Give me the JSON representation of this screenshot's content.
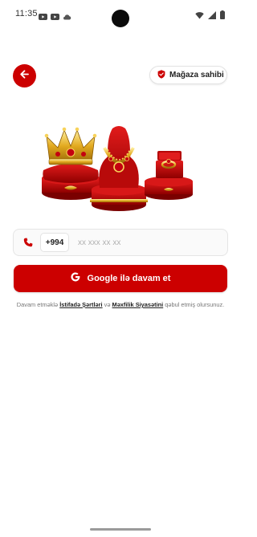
{
  "status_bar": {
    "time": "11:35",
    "left_icons": [
      "youtube-icon",
      "youtube-icon",
      "cloud-icon"
    ],
    "right_icons": [
      "wifi-icon",
      "signal-icon",
      "battery-icon"
    ]
  },
  "header": {
    "back_icon": "arrow-left-icon",
    "owner_label": "Mağaza sahibi",
    "owner_icon": "shield-check-icon"
  },
  "hero": {
    "image_name": "jewelry-display-image"
  },
  "phone": {
    "country_code": "+994",
    "placeholder": "xx xxx xx xx",
    "value": ""
  },
  "google_button": {
    "label": "Google ilə davam et",
    "icon": "google-icon"
  },
  "terms": {
    "prefix": "Davam etməklə ",
    "terms_link": "İstifadə Şərtləri",
    "middle": " və ",
    "privacy_link": "Məxfilik Siyasətini",
    "suffix": " qəbul etmiş olursunuz."
  },
  "colors": {
    "accent": "#cc0000",
    "background": "#ffffff"
  }
}
